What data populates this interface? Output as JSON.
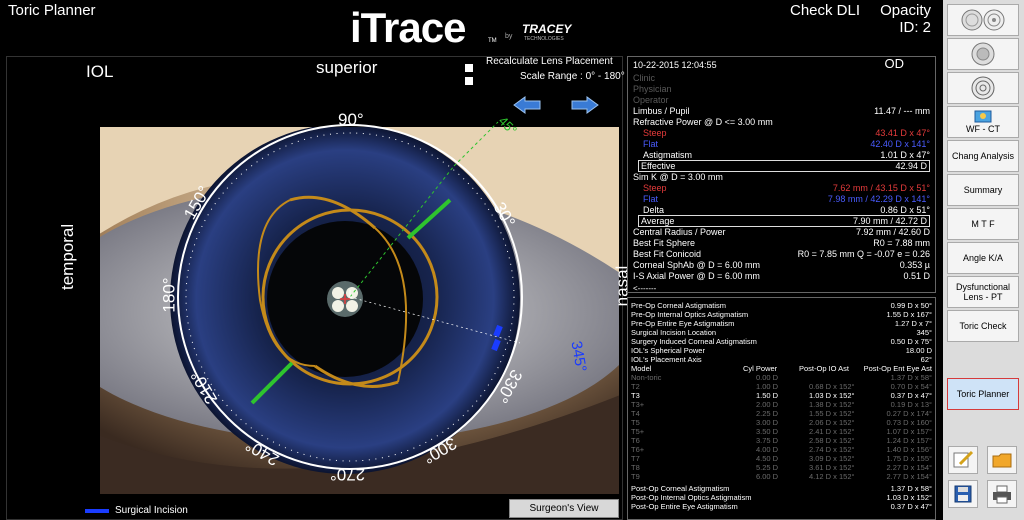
{
  "header": {
    "app_title": "Toric Planner",
    "check_dli": "Check DLI",
    "opacity_label": "Opacity",
    "opacity_id": "ID:  2",
    "logo": {
      "brand": "iTrace",
      "tm": "TM",
      "by": "by",
      "company": "TRACEY",
      "company_sub": "TECHNOLOGIES"
    }
  },
  "image_panel": {
    "mode_label": "IOL",
    "superior": "superior",
    "temporal": "temporal",
    "nasal": "nasal",
    "recalc_label": "Recalculate Lens Placement",
    "scale_range": "Scale Range : 0° - 180°",
    "dial_labels": [
      "90°",
      "150°",
      "180°",
      "210°",
      "240°",
      "270°",
      "300°",
      "330°",
      "30°",
      "345°",
      "45°"
    ],
    "legend_label": "Surgical Incision",
    "surgeons_view_button": "Surgeon's View"
  },
  "info_panel": {
    "datetime": "10-22-2015  12:04:55",
    "eye": "OD",
    "clinic": "Clinic",
    "physician": "Physician",
    "operator": "Operator",
    "limbus_label": "Limbus / Pupil",
    "limbus_value": "11.47 / --- mm",
    "refr_label": "Refractive Power @ D <= 3.00 mm",
    "steep_label": "Steep",
    "steep_value": "43.41 D x    47°",
    "flat_label": "Flat",
    "flat_value": "42.40 D x  141°",
    "astig_label": "Astigmatism",
    "astig_value": "1.01 D x    47°",
    "effective_label": "Effective",
    "effective_value": "42.94 D",
    "simk_label": "Sim K @ D = 3.00 mm",
    "simk_steep_label": "Steep",
    "simk_steep_value": "7.62 mm / 43.15 D x   51°",
    "simk_flat_label": "Flat",
    "simk_flat_value": "7.98 mm / 42.29 D x  141°",
    "delta_label": "Delta",
    "delta_value": "0.86 D x   51°",
    "average_label": "Average",
    "average_value": "7.90 mm / 42.72 D",
    "central_label": "Central Radius / Power",
    "central_value": "7.92 mm / 42.60 D",
    "bfs_label": "Best Fit Sphere",
    "bfs_value": "R0 = 7.88 mm",
    "bfc_label": "Best Fit Conicoid",
    "bfc_value": "R0 = 7.85 mm  Q = -0.07  e = 0.26",
    "sphab_label": "Corneal SphAb @ D = 6.00 mm",
    "sphab_value": "0.353 µ",
    "isaxial_label": "I-S Axial Power @ D = 6.00 mm",
    "isaxial_value": "0.51 D",
    "arrow_text": "<-------"
  },
  "toric_panel": {
    "rows_top": [
      {
        "label": "Pre-Op Corneal Astigmatism",
        "value": "0.99 D x    50°"
      },
      {
        "label": "Pre-Op Internal Optics Astigmatism",
        "value": "1.55 D x  167°"
      },
      {
        "label": "Pre-Op Entire Eye Astigmatism",
        "value": "1.27 D x     7°"
      },
      {
        "label": "Surgical Incision Location",
        "value": "345°"
      },
      {
        "label": "Surgery Induced Corneal Astigmatism",
        "value": "0.50 D x   75°"
      },
      {
        "label": "IOL's Spherical Power",
        "value": "18.00 D"
      },
      {
        "label": "IOL's Placement Axis",
        "value": "62°"
      }
    ],
    "table_headers": [
      "Model",
      "Cyl Power",
      "Post-Op IO Ast",
      "Post-Op Ent Eye Ast"
    ],
    "table_rows": [
      {
        "model": "Non-toric",
        "cyl": "0.00 D",
        "io": "",
        "ent": "1.37 D x   58°",
        "style": "dim"
      },
      {
        "model": "T2",
        "cyl": "1.00 D",
        "io": "0.68 D x 152°",
        "ent": "0.70 D x   54°",
        "style": "dim"
      },
      {
        "model": "T3",
        "cyl": "1.50 D",
        "io": "1.03 D x 152°",
        "ent": "0.37 D x   47°",
        "style": "bold"
      },
      {
        "model": "T3+",
        "cyl": "2.00 D",
        "io": "1.38 D x 152°",
        "ent": "0.19 D x   13°",
        "style": "dim"
      },
      {
        "model": "T4",
        "cyl": "2.25 D",
        "io": "1.55 D x 152°",
        "ent": "0.27 D x 174°",
        "style": "dim"
      },
      {
        "model": "T5",
        "cyl": "3.00 D",
        "io": "2.06 D x 152°",
        "ent": "0.73 D x 160°",
        "style": "dim"
      },
      {
        "model": "T5+",
        "cyl": "3.50 D",
        "io": "2.41 D x 152°",
        "ent": "1.07 D x 157°",
        "style": "dim"
      },
      {
        "model": "T6",
        "cyl": "3.75 D",
        "io": "2.58 D x 152°",
        "ent": "1.24 D x 157°",
        "style": "dim"
      },
      {
        "model": "T6+",
        "cyl": "4.00 D",
        "io": "2.74 D x 152°",
        "ent": "1.40 D x 156°",
        "style": "dim"
      },
      {
        "model": "T7",
        "cyl": "4.50 D",
        "io": "3.09 D x 152°",
        "ent": "1.75 D x 155°",
        "style": "dim"
      },
      {
        "model": "T8",
        "cyl": "5.25 D",
        "io": "3.61 D x 152°",
        "ent": "2.27 D x 154°",
        "style": "dim"
      },
      {
        "model": "T9",
        "cyl": "6.00 D",
        "io": "4.12 D x 152°",
        "ent": "2.77 D x 154°",
        "style": "dim"
      }
    ],
    "rows_bottom": [
      {
        "label": "Post-Op Corneal Astigmatism",
        "value": "1.37 D x    58°"
      },
      {
        "label": "Post-Op Internal Optics Astigmatism",
        "value": "1.03 D x  152°"
      },
      {
        "label": "Post-Op Entire Eye Astigmatism",
        "value": "0.37 D x    47°"
      }
    ]
  },
  "sidebar": {
    "buttons": [
      {
        "label": "WF - CT"
      },
      {
        "label": "Chang Analysis"
      },
      {
        "label": "Summary"
      },
      {
        "label": "M T F"
      },
      {
        "label": "Angle K/A"
      },
      {
        "label": "Dysfunctional Lens - PT"
      },
      {
        "label": "Toric Check"
      },
      {
        "label": "Toric Planner"
      }
    ]
  },
  "colors": {
    "orange": "#c48a1a",
    "green": "#2ec42e",
    "blue_arrow": "#3a7bd5",
    "incision": "#1a3cff",
    "steep": "#e53b3b",
    "flat": "#4a5cff"
  }
}
